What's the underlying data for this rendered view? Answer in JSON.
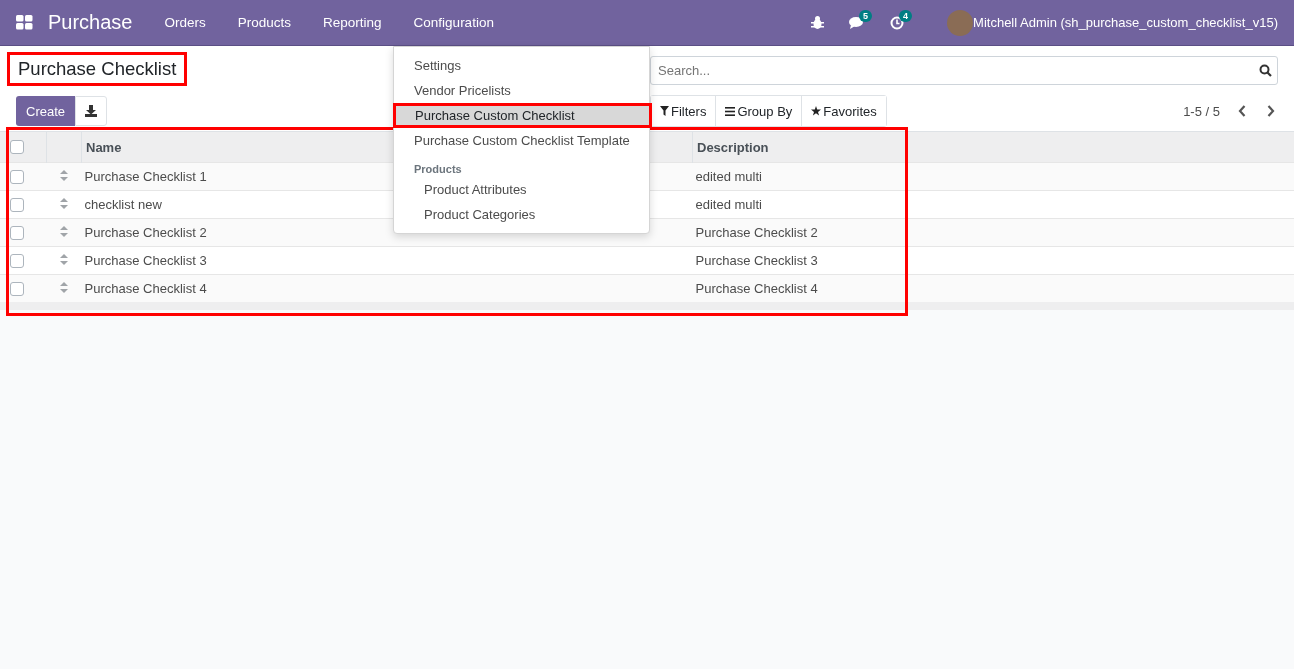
{
  "navbar": {
    "app_name": "Purchase",
    "menu": [
      "Orders",
      "Products",
      "Reporting",
      "Configuration"
    ],
    "messages_badge": "5",
    "activities_badge": "4",
    "user": "Mitchell Admin (sh_purchase_custom_checklist_v15)"
  },
  "dropdown": {
    "items": [
      {
        "kind": "item",
        "label": "Settings",
        "selected": false
      },
      {
        "kind": "item",
        "label": "Vendor Pricelists",
        "selected": false
      },
      {
        "kind": "item",
        "label": "Purchase Custom Checklist",
        "selected": true
      },
      {
        "kind": "item",
        "label": "Purchase Custom Checklist Template",
        "selected": false
      },
      {
        "kind": "header",
        "label": "Products"
      },
      {
        "kind": "subitem",
        "label": "Product Attributes",
        "selected": false
      },
      {
        "kind": "subitem",
        "label": "Product Categories",
        "selected": false
      }
    ]
  },
  "control_panel": {
    "title": "Purchase Checklist",
    "create_button": "Create",
    "search": {
      "placeholder": "Search..."
    },
    "filters": "Filters",
    "group_by": "Group By",
    "favorites": "Favorites",
    "pager": "1-5 / 5"
  },
  "table": {
    "columns": [
      "Name",
      "Description"
    ],
    "select_all_checked": false,
    "rows": [
      {
        "name": "Purchase Checklist 1",
        "description": "edited multi",
        "checked": false
      },
      {
        "name": "checklist new",
        "description": "edited multi",
        "checked": false
      },
      {
        "name": "Purchase Checklist 2",
        "description": "Purchase Checklist 2",
        "checked": false
      },
      {
        "name": "Purchase Checklist 3",
        "description": "Purchase Checklist 3",
        "checked": false
      },
      {
        "name": "Purchase Checklist 4",
        "description": "Purchase Checklist 4",
        "checked": false
      }
    ]
  }
}
